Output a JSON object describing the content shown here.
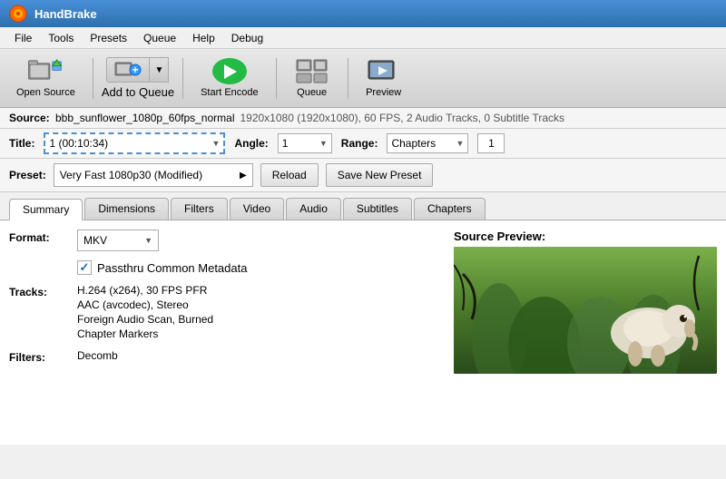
{
  "app": {
    "title": "HandBrake",
    "logo_emoji": "🎬"
  },
  "menu": {
    "items": [
      "File",
      "Tools",
      "Presets",
      "Queue",
      "Help",
      "Debug"
    ]
  },
  "toolbar": {
    "open_source_label": "Open Source",
    "add_to_queue_label": "Add to Queue",
    "start_encode_label": "Start Encode",
    "queue_label": "Queue",
    "preview_label": "Preview"
  },
  "source": {
    "label": "Source:",
    "filename": "bbb_sunflower_1080p_60fps_normal",
    "meta": "1920x1080 (1920x1080), 60 FPS, 2 Audio Tracks, 0 Subtitle Tracks"
  },
  "title_row": {
    "title_label": "Title:",
    "title_value": "1 (00:10:34)",
    "angle_label": "Angle:",
    "angle_value": "1",
    "range_label": "Range:",
    "range_value": "Chapters",
    "range_num": "1"
  },
  "preset_row": {
    "preset_label": "Preset:",
    "preset_value": "Very Fast 1080p30 (Modified)",
    "reload_label": "Reload",
    "save_preset_label": "Save New Preset"
  },
  "tabs": {
    "items": [
      "Summary",
      "Dimensions",
      "Filters",
      "Video",
      "Audio",
      "Subtitles",
      "Chapters"
    ],
    "active": "Summary"
  },
  "summary": {
    "format_label": "Format:",
    "format_value": "MKV",
    "metadata_label": "Passthru Common Metadata",
    "tracks_label": "Tracks:",
    "track1": "H.264 (x264), 30 FPS PFR",
    "track2": "AAC (avcodec), Stereo",
    "track3": "Foreign Audio Scan, Burned",
    "track4": "Chapter Markers",
    "filters_label": "Filters:",
    "filters_value": "Decomb",
    "source_preview_label": "Source Preview:"
  }
}
